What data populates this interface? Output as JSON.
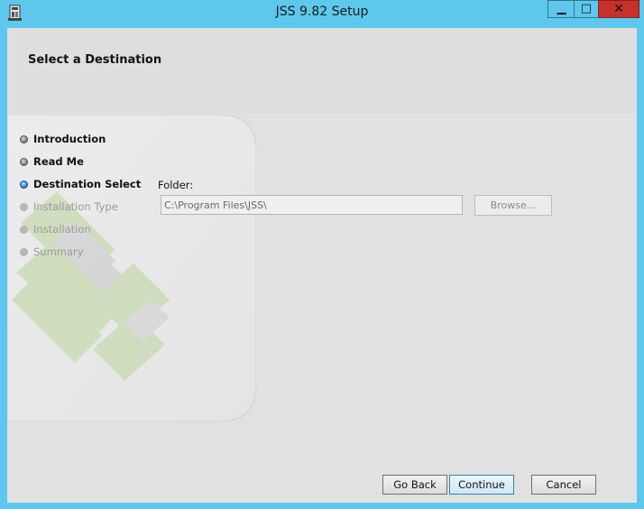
{
  "window": {
    "title": "JSS 9.82 Setup",
    "controls": {
      "minimize": "▁",
      "maximize": "□",
      "close": "✕"
    }
  },
  "header": {
    "heading": "Select a Destination"
  },
  "steps": [
    {
      "label": "Introduction",
      "state": "done"
    },
    {
      "label": "Read Me",
      "state": "done"
    },
    {
      "label": "Destination Select",
      "state": "current"
    },
    {
      "label": "Installation Type",
      "state": "pending"
    },
    {
      "label": "Installation",
      "state": "pending"
    },
    {
      "label": "Summary",
      "state": "pending"
    }
  ],
  "folder": {
    "label": "Folder:",
    "value": "C:\\Program Files\\JSS\\",
    "browse_label": "Browse..."
  },
  "buttons": {
    "back": "Go Back",
    "continue": "Continue",
    "cancel": "Cancel"
  },
  "colors": {
    "frame": "#5cc8ec",
    "close": "#c7312b",
    "accent_green": "#b8d39a"
  }
}
